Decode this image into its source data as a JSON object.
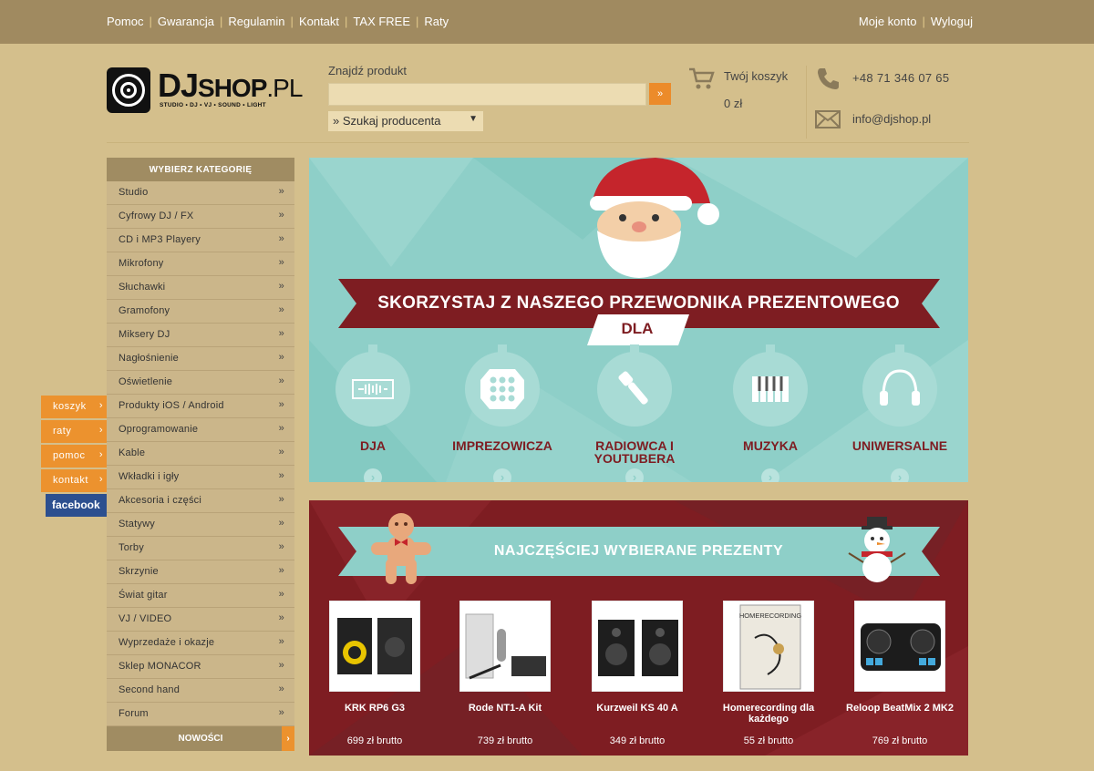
{
  "top_nav": {
    "links": [
      "Pomoc",
      "Gwarancja",
      "Regulamin",
      "Kontakt",
      "TAX FREE",
      "Raty"
    ],
    "account": [
      "Moje konto",
      "Wyloguj"
    ]
  },
  "logo": {
    "brand_bold": "DJ",
    "brand_mid": "SHOP",
    "brand_tld": ".PL",
    "tagline": "STUDIO • DJ • VJ • SOUND • LIGHT"
  },
  "search": {
    "label": "Znajdź produkt",
    "placeholder": "",
    "button": "»",
    "producer_select": "» Szukaj producenta"
  },
  "cart": {
    "label": "Twój koszyk",
    "value": "0 zł"
  },
  "contact": {
    "phone": "+48 71 346 07 65",
    "email": "info@djshop.pl"
  },
  "side_tabs": [
    "koszyk",
    "raty",
    "pomoc",
    "kontakt"
  ],
  "facebook": "facebook",
  "sidebar": {
    "header": "WYBIERZ KATEGORIĘ",
    "categories": [
      "Studio",
      "Cyfrowy DJ / FX",
      "CD i MP3 Playery",
      "Mikrofony",
      "Słuchawki",
      "Gramofony",
      "Miksery DJ",
      "Nagłośnienie",
      "Oświetlenie",
      "Produkty iOS / Android",
      "Oprogramowanie",
      "Kable",
      "Wkładki i igły",
      "Akcesoria i części",
      "Statywy",
      "Torby",
      "Skrzynie",
      "Świat gitar",
      "VJ / VIDEO",
      "Wyprzedaże i okazje",
      "Sklep MONACOR",
      "Second hand",
      "Forum"
    ],
    "footer": "NOWOŚCI",
    "chevron": "»",
    "footer_arrow": "›"
  },
  "banner": {
    "title": "SKORZYSTAJ Z NASZEGO PRZEWODNIKA PREZENTOWEGO",
    "subtitle": "DLA",
    "groups": [
      "DJA",
      "IMPREZOWICZA",
      "RADIOWCA I YOUTUBERA",
      "MUZYKA",
      "UNIWERSALNE"
    ],
    "arrow": "›"
  },
  "gifts": {
    "title": "NAJCZĘŚCIEJ WYBIERANE PREZENTY",
    "products": [
      {
        "name": "KRK RP6 G3",
        "price": "699 zł brutto"
      },
      {
        "name": "Rode NT1-A Kit",
        "price": "739 zł brutto"
      },
      {
        "name": "Kurzweil KS 40 A",
        "price": "349 zł brutto"
      },
      {
        "name": "Homerecording dla każdego",
        "price": "55 zł brutto"
      },
      {
        "name": "Reloop BeatMix 2 MK2",
        "price": "769 zł brutto"
      }
    ],
    "book_cover": "HOMERECORDING"
  },
  "colors": {
    "background": "#d4bf8c",
    "topbar": "#a08a60",
    "accent": "#ec8b2a",
    "teal": "#8ecfc8",
    "maroon": "#7e1d22"
  },
  "icons": [
    "cart-icon",
    "phone-icon",
    "mail-icon",
    "santa-icon",
    "gingerbread-icon",
    "snowman-icon"
  ]
}
